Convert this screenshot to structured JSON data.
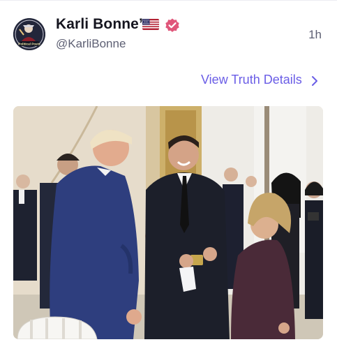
{
  "post": {
    "author": {
      "display_name": "Karli Bonne’",
      "handle": "@KarliBonne",
      "avatar_caption": "Political Posts"
    },
    "timestamp": "1h",
    "details_link": "View Truth Details",
    "icons": {
      "flag": "us-flag-icon",
      "verified": "verified-badge-icon",
      "chevron": "chevron-right-icon"
    },
    "colors": {
      "verified": "#e0567a",
      "link": "#6a5de6",
      "handle": "#5d5f73"
    }
  }
}
